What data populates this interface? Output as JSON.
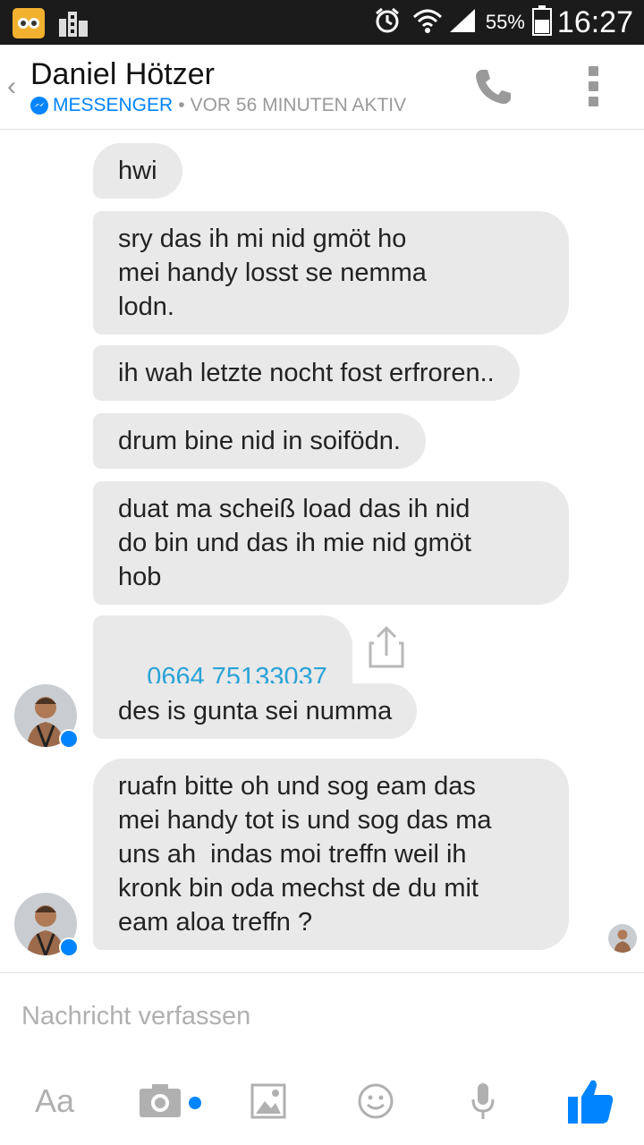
{
  "status_bar": {
    "battery_percent": "55%",
    "time": "16:27",
    "icons": [
      "app-notification-icon",
      "building-icon",
      "alarm-icon",
      "wifi-icon",
      "signal-icon",
      "battery-icon"
    ]
  },
  "header": {
    "back_glyph": "‹",
    "contact_name": "Daniel Hötzer",
    "app_label": "MESSENGER",
    "separator": "•",
    "activity": "VOR 56 MINUTEN AKTIV",
    "icons": [
      "back-chevron-icon",
      "phone-icon",
      "more-vert-icon"
    ]
  },
  "messages": [
    {
      "text": "hwi"
    },
    {
      "text": "sry das ih mi nid gmöt ho\nmei handy losst se nemma\nlodn."
    },
    {
      "text": "ih wah letzte nocht fost erfroren.."
    },
    {
      "text": "drum bine nid in soifödn."
    },
    {
      "text": "duat ma scheiß load das ih nid\ndo bin und das ih mie nid gmöt\nhob"
    },
    {
      "text": "0664 75133037",
      "is_link": true
    },
    {
      "text": "des is gunta sei numma"
    },
    {
      "text": "ruafn bitte oh und sog eam das\nmei handy tot is und sog das ma\nuns ah  indas moi treffn weil ih\nkronk bin oda mechst de du mit\neam aloa treffn ?"
    }
  ],
  "composer": {
    "placeholder": "Nachricht verfassen"
  },
  "toolbar": {
    "text_button": "Aa",
    "icons": [
      "camera-icon",
      "image-icon",
      "emoji-icon",
      "microphone-icon",
      "like-icon"
    ]
  },
  "colors": {
    "accent": "#0084ff",
    "bubble": "#e9e9e9",
    "link": "#2aa2d8",
    "muted": "#9a9a9a",
    "status_bar": "#1b1b1b"
  }
}
